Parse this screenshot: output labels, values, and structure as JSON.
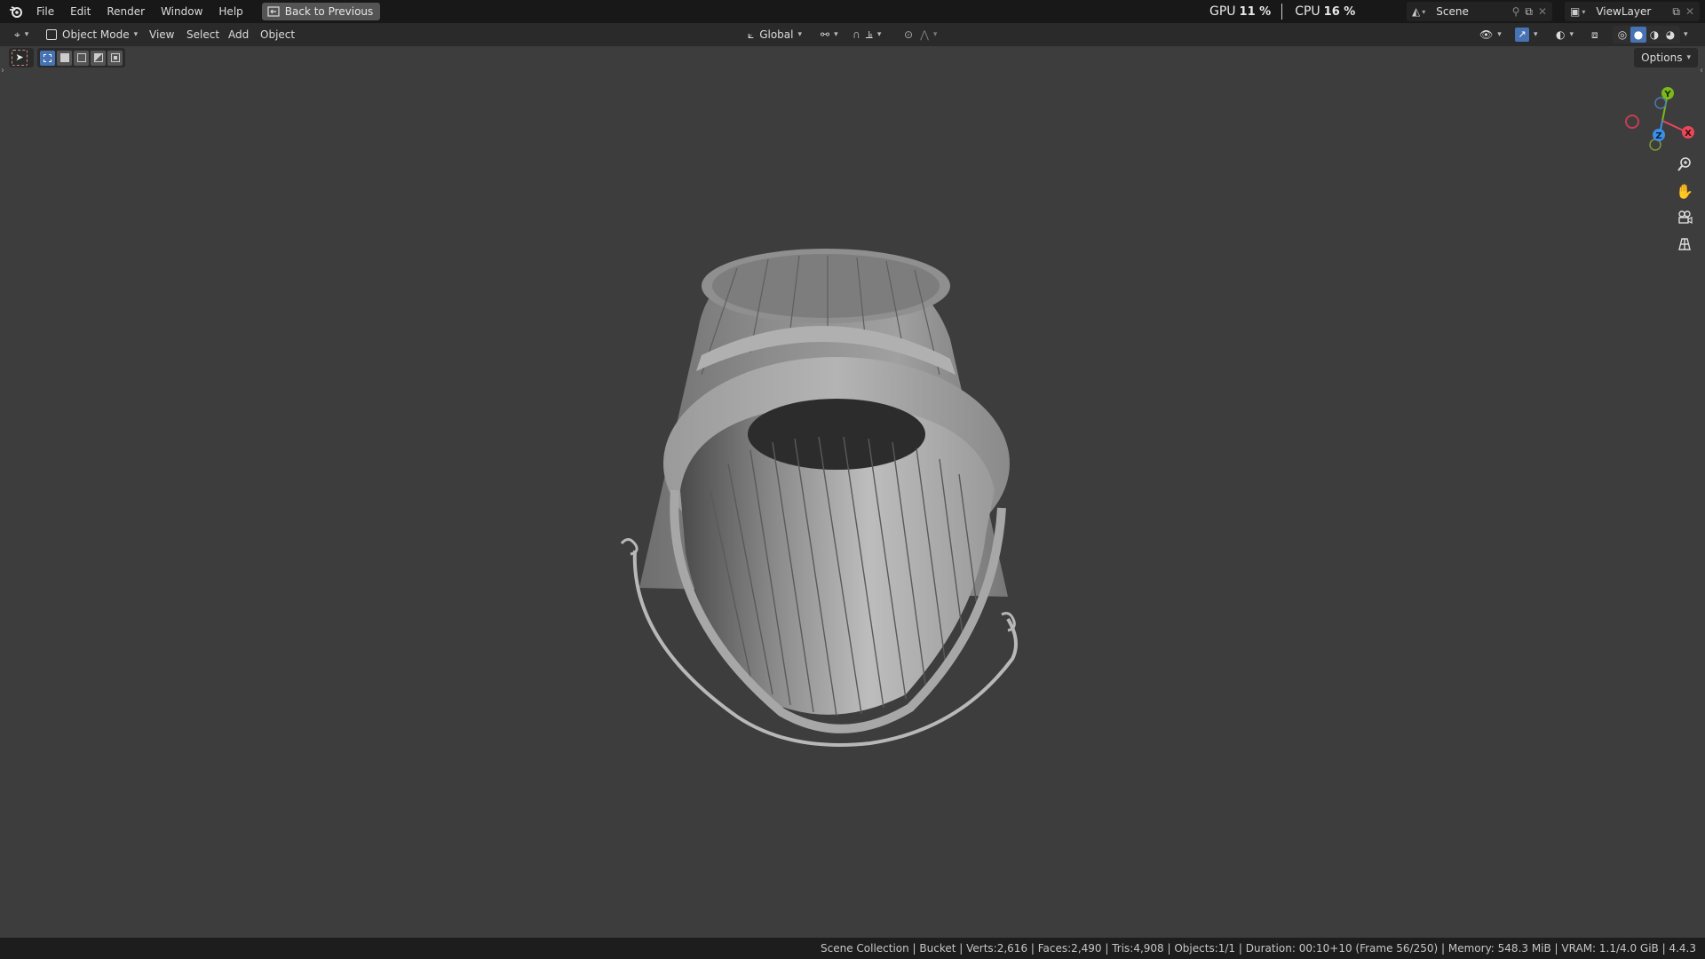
{
  "topbar": {
    "menu": [
      "File",
      "Edit",
      "Render",
      "Window",
      "Help"
    ],
    "back_button": "Back to Previous",
    "gpu_label": "GPU",
    "gpu_value": "11 %",
    "cpu_label": "CPU",
    "cpu_value": "16 %",
    "scene_name": "Scene",
    "view_layer": "ViewLayer"
  },
  "header": {
    "mode": "Object Mode",
    "menus": [
      "View",
      "Select",
      "Add",
      "Object"
    ],
    "orientation": "Global"
  },
  "viewport": {
    "options_label": "Options",
    "object_name": "Bucket",
    "gizmo": {
      "x_label": "X",
      "y_label": "Y",
      "z_label": "Z"
    }
  },
  "statusbar": {
    "text": "Scene Collection | Bucket | Verts:2,616 | Faces:2,490 | Tris:4,908 | Objects:1/1 | Duration: 00:10+10 (Frame 56/250) | Memory: 548.3 MiB | VRAM: 1.1/4.0 GiB | 4.4.3"
  },
  "colors": {
    "viewport_bg": "#3d3d3d",
    "header_bg": "#2a2a2a",
    "topbar_bg": "#181818",
    "accent_blue": "#4772b3",
    "axis_x": "#e8485a",
    "axis_y": "#7bb81c",
    "axis_z": "#3b8fe8"
  },
  "icons": [
    "blender-logo-icon",
    "back-icon",
    "editor-type-icon",
    "object-mode-icon",
    "transform-orientation-icon",
    "pivot-icon",
    "snap-icon",
    "proportional-edit-icon",
    "visibility-icon",
    "gizmo-icon",
    "overlay-icon",
    "xray-icon",
    "wireframe-shading-icon",
    "solid-shading-icon",
    "material-shading-icon",
    "rendered-shading-icon",
    "zoom-icon",
    "pan-hand-icon",
    "camera-icon",
    "grid-icon"
  ]
}
